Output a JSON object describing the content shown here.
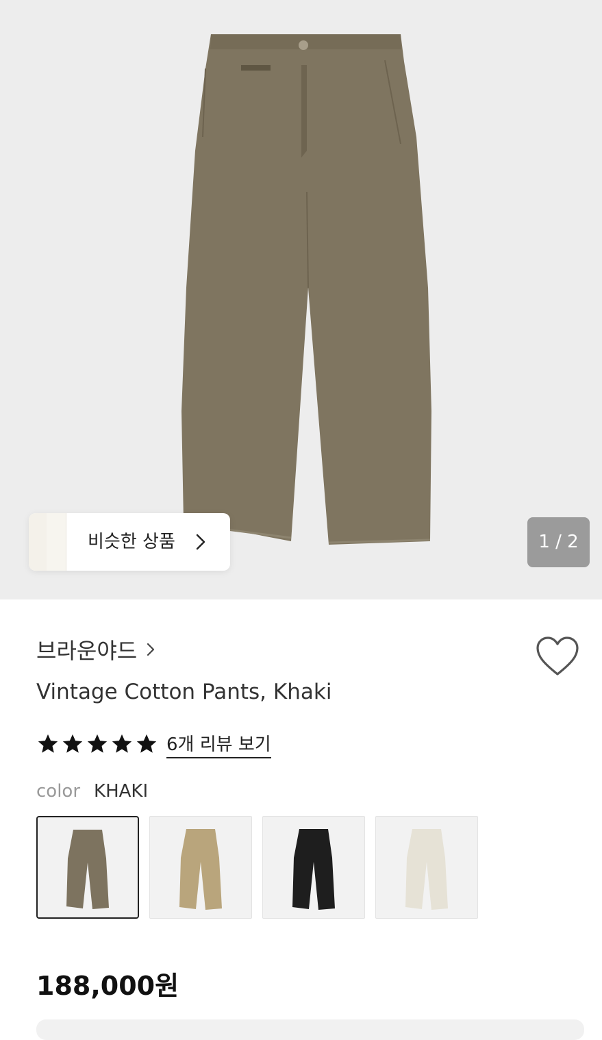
{
  "hero": {
    "image_alt": "",
    "similar_label": "비슷한 상품",
    "pager": "1 / 2"
  },
  "product": {
    "brand": "브라운야드",
    "title": "Vintage Cotton Pants, Khaki",
    "rating_stars": 5,
    "review_link": "6개 리뷰 보기",
    "color_key": "color",
    "color_value": "KHAKI",
    "price": "188,000원"
  },
  "swatches": [
    {
      "color": "#7d735f",
      "selected": true
    },
    {
      "color": "#b9a57c",
      "selected": false
    },
    {
      "color": "#1e1e1e",
      "selected": false
    },
    {
      "color": "#e6e2d6",
      "selected": false
    }
  ],
  "colors": {
    "pants_main": "#7f7560",
    "hero_bg": "#ededed",
    "pager_bg": "#9b9b9b"
  }
}
